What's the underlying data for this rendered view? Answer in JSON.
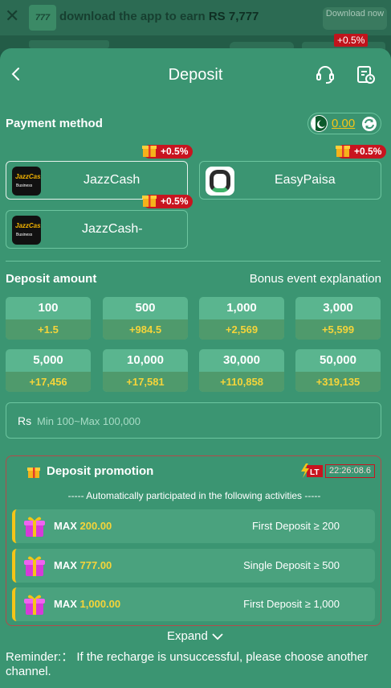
{
  "banner": {
    "logo_text": "777",
    "text": "download the app to earn",
    "amount": "RS 7,777",
    "download_label": "Download now"
  },
  "header": {
    "title": "Deposit",
    "underlay_bonus": "+0.5%"
  },
  "payment": {
    "label": "Payment method",
    "balance": "0.00",
    "methods": [
      {
        "name": "JazzCash",
        "bonus": "+0.5%",
        "logo_text": "JazzCash",
        "logo_sub": "Business"
      },
      {
        "name": "EasyPaisa",
        "bonus": "+0.5%"
      },
      {
        "name": "JazzCash-",
        "bonus": "+0.5%",
        "logo_text": "JazzCash",
        "logo_sub": "Business"
      }
    ]
  },
  "deposit": {
    "label": "Deposit amount",
    "bonus_link": "Bonus event explanation",
    "amounts": [
      {
        "amount": "100",
        "bonus": "+1.5"
      },
      {
        "amount": "500",
        "bonus": "+984.5"
      },
      {
        "amount": "1,000",
        "bonus": "+2,569"
      },
      {
        "amount": "3,000",
        "bonus": "+5,599"
      },
      {
        "amount": "5,000",
        "bonus": "+17,456"
      },
      {
        "amount": "10,000",
        "bonus": "+17,581"
      },
      {
        "amount": "30,000",
        "bonus": "+110,858"
      },
      {
        "amount": "50,000",
        "bonus": "+319,135"
      }
    ],
    "currency": "Rs",
    "placeholder": "Min 100~Max 100,000"
  },
  "promotion": {
    "title": "Deposit promotion",
    "badge": "LT",
    "timer": "22:26:08.6",
    "auto_text": "----- Automatically participated in the following activities -----",
    "max_label": "MAX",
    "rows": [
      {
        "max": "200.00",
        "condition": "First Deposit ≥ 200"
      },
      {
        "max": "777.00",
        "condition": "Single Deposit ≥ 500"
      },
      {
        "max": "1,000.00",
        "condition": "First Deposit ≥ 1,000"
      }
    ],
    "expand_label": "Expand"
  },
  "reminder": "Reminder:： If the recharge is unsuccessful, please choose another channel.",
  "colors": {
    "sheet": "#3b9572",
    "accent_yellow": "#f5c518",
    "bonus_red": "#c8141f"
  }
}
